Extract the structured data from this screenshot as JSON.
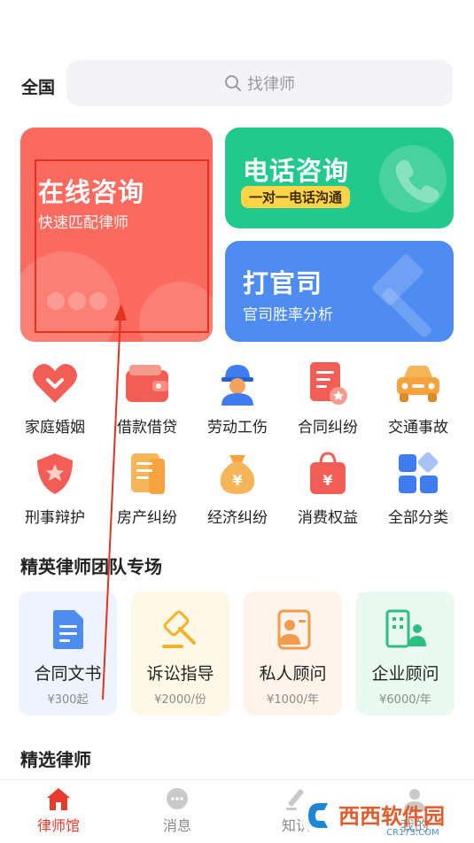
{
  "header": {
    "region_label": "全国",
    "search_placeholder": "找律师"
  },
  "cards": {
    "online": {
      "title": "在线咨询",
      "subtitle": "快速匹配律师",
      "color": "#fb6a5e"
    },
    "phone": {
      "title": "电话咨询",
      "tag": "一对一电话沟通",
      "color": "#22c98c"
    },
    "lawsuit": {
      "title": "打官司",
      "subtitle": "官司胜率分析",
      "color": "#4f8cf2"
    }
  },
  "categories": [
    {
      "label": "家庭婚姻",
      "icon": "heart-icon"
    },
    {
      "label": "借款借贷",
      "icon": "wallet-icon"
    },
    {
      "label": "劳动工伤",
      "icon": "worker-icon"
    },
    {
      "label": "合同纠纷",
      "icon": "contract-icon"
    },
    {
      "label": "交通事故",
      "icon": "car-icon"
    },
    {
      "label": "刑事辩护",
      "icon": "shield-icon"
    },
    {
      "label": "房产纠纷",
      "icon": "house-doc-icon"
    },
    {
      "label": "经济纠纷",
      "icon": "money-bag-icon"
    },
    {
      "label": "消费权益",
      "icon": "shopping-bag-icon"
    },
    {
      "label": "全部分类",
      "icon": "grid-icon"
    }
  ],
  "elite_section": {
    "title": "精英律师团队专场",
    "services": [
      {
        "name": "合同文书",
        "price": "¥300起",
        "icon": "document-icon",
        "bg": "#eef4ff"
      },
      {
        "name": "诉讼指导",
        "price": "¥2000/份",
        "icon": "gavel-icon",
        "bg": "#fff8e6"
      },
      {
        "name": "私人顾问",
        "price": "¥1000/年",
        "icon": "person-card-icon",
        "bg": "#fff3ea"
      },
      {
        "name": "企业顾问",
        "price": "¥6000/年",
        "icon": "building-icon",
        "bg": "#eafaf3"
      }
    ]
  },
  "selected_section": {
    "title": "精选律师"
  },
  "tabbar": {
    "tabs": [
      {
        "label": "律师馆",
        "icon": "home-icon",
        "active": true
      },
      {
        "label": "消息",
        "icon": "chat-icon",
        "active": false
      },
      {
        "label": "知识",
        "icon": "knowledge-icon",
        "active": false
      },
      {
        "label": "我的",
        "icon": "user-icon",
        "active": false
      }
    ]
  },
  "watermark": {
    "text": "西西软件园",
    "sub": "CR173.COM"
  }
}
